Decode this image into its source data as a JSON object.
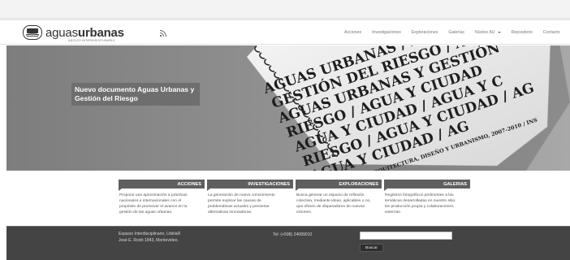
{
  "header": {
    "logo_thin": "aguas",
    "logo_bold": "urbanas",
    "logo_sub": "NÚCLEO INTERDISCIPLINARIO",
    "nav": [
      {
        "label": "Acciones",
        "dropdown": false
      },
      {
        "label": "Investigaciones",
        "dropdown": false
      },
      {
        "label": "Exploraciones",
        "dropdown": false
      },
      {
        "label": "Galerías",
        "dropdown": false
      },
      {
        "label": "Núcleo AU",
        "dropdown": true
      },
      {
        "label": "Repositorio",
        "dropdown": false
      },
      {
        "label": "Contacto",
        "dropdown": false
      }
    ]
  },
  "hero": {
    "caption_line1": "Nuevo documento Aguas Urbanas y",
    "caption_line2": "Gestión del Riesgo",
    "image_text_lines": [
      "AGUAS URBANAS / AGUA Y CIU",
      "GESTIÓN DEL RIESGO / AGUA",
      "AGUAS URBANAS Y GESTIÓN",
      "RIESGO / AGUA Y CIUDAD",
      "AGUA Y CIUDAD / AGUA Y C",
      "RIESGO / AGUA Y CIUDAD / AG",
      "AGUA Y CIUDAD / AG",
      "FACULTAD DE ARQUITECTURA, DISEÑO Y URBANISMO, 2007-2010 / INS"
    ]
  },
  "sections": [
    {
      "title": "ACCIONES",
      "lines": [
        "Propone una aproximación a prácticas",
        "nacionales e internacionales con el",
        "propósito de promover el avance en la",
        "gestión de las aguas urbanas."
      ]
    },
    {
      "title": "INVESTIGACIONES",
      "lines": [
        "La generación de nuevo conocimiento",
        "permite explicar las causas de",
        "problemáticas actuales y presentar",
        "alternativas innovadoras."
      ]
    },
    {
      "title": "EXPLORACIONES",
      "lines": [
        "Busca generar un espacio de reflexión",
        "colectiva, mediante ideas, aplicables o no,",
        "que oficien de disparadores de nuevas",
        "visiones."
      ]
    },
    {
      "title": "GALERIAS",
      "lines": [
        "Registros fotográficos pertinentes a las",
        "temáticas desarrolladas en nuestro sitio.",
        "De producción propia y colaboraciones",
        "externas."
      ]
    }
  ],
  "footer": {
    "address_line1": "Espacio Interdisciplinario, UdelaR",
    "address_line2": "José E. Rodó 1843, Montevideo.",
    "tel": "Tel: (+598) 24089010",
    "search_value": "",
    "search_button": "Buscar"
  }
}
